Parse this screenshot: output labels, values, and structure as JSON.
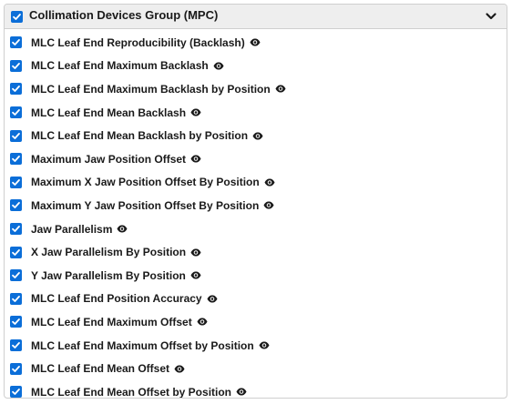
{
  "group": {
    "title": "Collimation Devices Group (MPC)",
    "checked": true,
    "expanded": true
  },
  "icons": {
    "checkbox": "checkbox-checked-icon",
    "toggle": "chevron-down-icon",
    "visibility": "eye-icon"
  },
  "colors": {
    "checkbox_fill": "#0b6ed8",
    "header_bg": "#eeeeee",
    "text": "#1a1a1a"
  },
  "items": [
    {
      "label": "MLC Leaf End Reproducibility (Backlash)",
      "checked": true
    },
    {
      "label": "MLC Leaf End Maximum Backlash",
      "checked": true
    },
    {
      "label": "MLC Leaf End Maximum Backlash by Position",
      "checked": true
    },
    {
      "label": "MLC Leaf End Mean Backlash",
      "checked": true
    },
    {
      "label": "MLC Leaf End Mean Backlash by Position",
      "checked": true
    },
    {
      "label": "Maximum Jaw Position Offset",
      "checked": true
    },
    {
      "label": "Maximum X Jaw Position Offset By Position",
      "checked": true
    },
    {
      "label": "Maximum Y Jaw Position Offset By Position",
      "checked": true
    },
    {
      "label": "Jaw Parallelism",
      "checked": true
    },
    {
      "label": "X Jaw Parallelism By Position",
      "checked": true
    },
    {
      "label": "Y Jaw Parallelism By Position",
      "checked": true
    },
    {
      "label": "MLC Leaf End Position Accuracy",
      "checked": true
    },
    {
      "label": "MLC Leaf End Maximum Offset",
      "checked": true
    },
    {
      "label": "MLC Leaf End Maximum Offset by Position",
      "checked": true
    },
    {
      "label": "MLC Leaf End Mean Offset",
      "checked": true
    },
    {
      "label": "MLC Leaf End Mean Offset by Position",
      "checked": true
    }
  ]
}
